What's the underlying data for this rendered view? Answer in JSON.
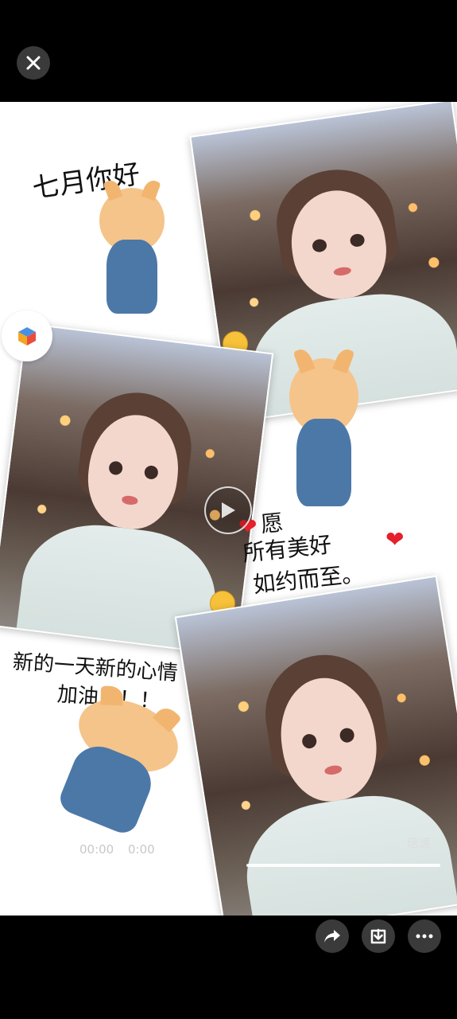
{
  "header": {
    "close_icon": "close-icon"
  },
  "video": {
    "captions": {
      "top_left": "七月你好",
      "middle_right_line1": "愿",
      "middle_right_line2": "所有美好",
      "middle_right_line3": "如约而至。",
      "bottom_left_line1": "新的一天新的心情",
      "bottom_left_line2": "加油！！！"
    },
    "player": {
      "current_time": "00:00",
      "duration": "0:00",
      "speed_label": "倍速",
      "play_icon": "play-icon"
    }
  },
  "side": {
    "app_icon": "cube-app-icon"
  },
  "footer": {
    "share_icon": "share-icon",
    "download_icon": "download-icon",
    "more_icon": "more-icon"
  },
  "colors": {
    "background": "#000000",
    "button_bg": "#3a3a3a",
    "heart": "#e5202a"
  }
}
